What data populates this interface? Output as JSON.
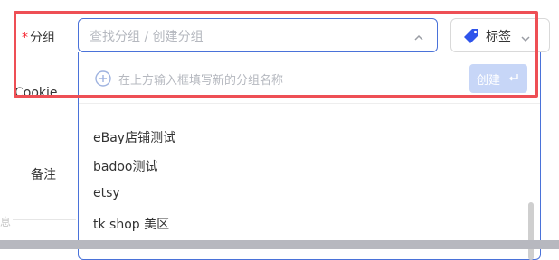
{
  "form": {
    "group_label": "分组",
    "required_mark": "*",
    "cookie_label": "Cookie",
    "remark_label": "备注",
    "cut_text": "息"
  },
  "group_select": {
    "placeholder": "查找分组 / 创建分组",
    "chevron_icon": "chevron-up-icon"
  },
  "tag_button": {
    "label": "标签",
    "icon": "tag-icon",
    "icon_color": "#2f54eb"
  },
  "dropdown": {
    "create_hint": "在上方输入框填写新的分组名称",
    "create_button": "创建",
    "create_button_icon": "enter-icon",
    "items": [
      "eBay店铺测试",
      "badoo测试",
      "etsy",
      "tk shop 美区"
    ]
  },
  "colors": {
    "accent": "#4a72d9",
    "highlight_box": "#ee4f55",
    "create_button_bg": "#c7d6f7",
    "required": "#f5222d"
  }
}
